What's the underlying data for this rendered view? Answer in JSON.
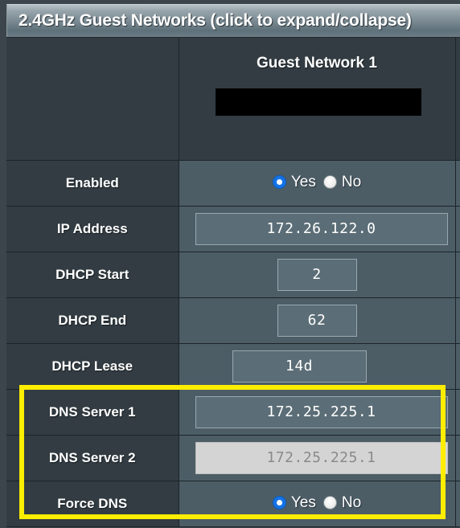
{
  "header": {
    "title": "2.4GHz Guest Networks (click to expand/collapse)"
  },
  "network": {
    "column_title": "Guest Network 1",
    "ssid_value": "",
    "ssid_redacted": true
  },
  "radio_labels": {
    "yes": "Yes",
    "no": "No"
  },
  "rows": [
    {
      "label": "Enabled",
      "type": "radio",
      "selected": "Yes"
    },
    {
      "label": "IP Address",
      "type": "text",
      "value": "172.26.122.0"
    },
    {
      "label": "DHCP Start",
      "type": "text",
      "value": "2"
    },
    {
      "label": "DHCP End",
      "type": "text",
      "value": "62"
    },
    {
      "label": "DHCP Lease",
      "type": "text",
      "value": "14d"
    },
    {
      "label": "DNS Server 1",
      "type": "text",
      "value": "172.25.225.1"
    },
    {
      "label": "DNS Server 2",
      "type": "text",
      "value": "172.25.225.1",
      "disabled": true
    },
    {
      "label": "Force DNS",
      "type": "radio",
      "selected": "Yes"
    }
  ],
  "annotation": {
    "highlight_color": "#ffed00",
    "highlight_rows": [
      "DNS Server 1",
      "DNS Server 2",
      "Force DNS"
    ]
  },
  "colors": {
    "label_cell": "#323c42",
    "value_cell": "#4c5d66",
    "input_bg": "#5b6d76",
    "input_disabled_bg": "#d4d4d4",
    "radio_selected": "#1473e6",
    "grid_line": "#1d2428"
  }
}
